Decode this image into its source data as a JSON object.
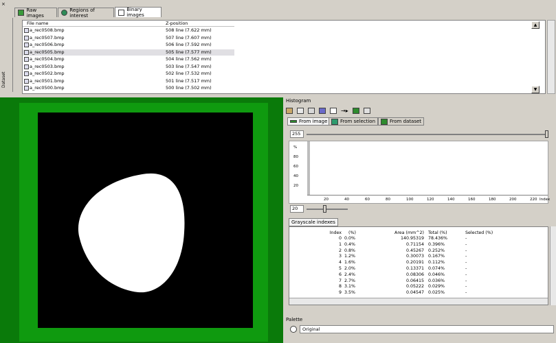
{
  "tabs": [
    {
      "label": "Raw images",
      "icon": "raw-images-icon"
    },
    {
      "label": "Regions of interest",
      "icon": "roi-icon"
    },
    {
      "label": "Binary images",
      "icon": "binary-images-icon"
    }
  ],
  "dataset_label": "Dataset",
  "file_list": {
    "columns": [
      "File name",
      "Z-position"
    ],
    "rows": [
      {
        "name": "a_rec0508.bmp",
        "z": "508 line (7.622 mm)"
      },
      {
        "name": "a_rec0507.bmp",
        "z": "507 line (7.607 mm)"
      },
      {
        "name": "a_rec0506.bmp",
        "z": "506 line (7.592 mm)"
      },
      {
        "name": "a_rec0505.bmp",
        "z": "505 line (7.577 mm)"
      },
      {
        "name": "a_rec0504.bmp",
        "z": "504 line (7.562 mm)"
      },
      {
        "name": "a_rec0503.bmp",
        "z": "503 line (7.547 mm)"
      },
      {
        "name": "a_rec0502.bmp",
        "z": "502 line (7.532 mm)"
      },
      {
        "name": "a_rec0501.bmp",
        "z": "501 line (7.517 mm)"
      },
      {
        "name": "a_rec0500.bmp",
        "z": "500 line (7.502 mm)"
      }
    ],
    "selected_index": 3
  },
  "histogram": {
    "title": "Histogram",
    "source_tabs": [
      "From image",
      "From selection",
      "From dataset"
    ],
    "top_value": "255",
    "bottom_value": "20",
    "y_ticks": [
      "%",
      "80",
      "60",
      "40",
      "20"
    ],
    "x_ticks": [
      "20",
      "40",
      "60",
      "80",
      "100",
      "120",
      "140",
      "160",
      "180",
      "200",
      "220"
    ],
    "x_label": "Index",
    "colors": {
      "from_image": "#2e8b2e",
      "from_selection": "#2e9b6e",
      "from_dataset": "#2e8b2e"
    }
  },
  "grayscale": {
    "tab": "Grayscale indexes",
    "headers": {
      "index": "Index",
      "pct": "(%)",
      "area": "Area (mm^2)",
      "total": "Total (%)",
      "selected": "Selected (%)"
    },
    "rows": [
      {
        "i": "0",
        "p": "0.0%",
        "a": "140.95319",
        "t": "78.436%",
        "s": "-"
      },
      {
        "i": "1",
        "p": "0.4%",
        "a": "0.71154",
        "t": "0.396%",
        "s": "-"
      },
      {
        "i": "2",
        "p": "0.8%",
        "a": "0.45267",
        "t": "0.252%",
        "s": "-"
      },
      {
        "i": "3",
        "p": "1.2%",
        "a": "0.30073",
        "t": "0.167%",
        "s": "-"
      },
      {
        "i": "4",
        "p": "1.6%",
        "a": "0.20191",
        "t": "0.112%",
        "s": "-"
      },
      {
        "i": "5",
        "p": "2.0%",
        "a": "0.13371",
        "t": "0.074%",
        "s": "-"
      },
      {
        "i": "6",
        "p": "2.4%",
        "a": "0.08306",
        "t": "0.046%",
        "s": "-"
      },
      {
        "i": "7",
        "p": "2.7%",
        "a": "0.06415",
        "t": "0.036%",
        "s": "-"
      },
      {
        "i": "8",
        "p": "3.1%",
        "a": "0.05222",
        "t": "0.029%",
        "s": "-"
      },
      {
        "i": "9",
        "p": "3.5%",
        "a": "0.04547",
        "t": "0.025%",
        "s": "-"
      }
    ]
  },
  "palette": {
    "title": "Palette",
    "value": "Original"
  },
  "colors": {
    "image_green": "#0f9a0f",
    "image_dark_green": "#0a7a0a",
    "foreground": "#ffffff",
    "background": "#000000"
  }
}
